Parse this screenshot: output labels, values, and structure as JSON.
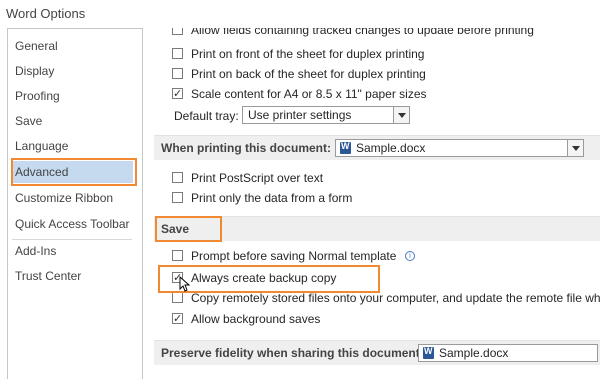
{
  "window": {
    "title": "Word Options"
  },
  "nav": {
    "items": [
      {
        "label": "General"
      },
      {
        "label": "Display"
      },
      {
        "label": "Proofing"
      },
      {
        "label": "Save"
      },
      {
        "label": "Language"
      },
      {
        "label": "Advanced"
      },
      {
        "label": "Customize Ribbon"
      },
      {
        "label": "Quick Access Toolbar"
      },
      {
        "label": "Add-Ins"
      },
      {
        "label": "Trust Center"
      }
    ],
    "selected": "Advanced"
  },
  "print": {
    "partial_top_label": "Allow fields containing tracked changes to update before printing",
    "front_label": "Print on front of the sheet for duplex printing",
    "back_label": "Print on back of the sheet for duplex printing",
    "scale_label": "Scale content for A4 or 8.5 x 11\" paper sizes",
    "scale_checked": true,
    "default_tray_label": "Default tray:",
    "default_tray_value": "Use printer settings"
  },
  "when_printing": {
    "title": "When printing this document:",
    "document": "Sample.docx",
    "postscript_label": "Print PostScript over text",
    "form_data_label": "Print only the data from a form"
  },
  "save": {
    "title": "Save",
    "prompt_label": "Prompt before saving Normal template",
    "backup_label": "Always create backup copy",
    "backup_checked": true,
    "remote_label": "Copy remotely stored files onto your computer, and update the remote file when sa",
    "background_label": "Allow background saves",
    "background_checked": true
  },
  "fidelity": {
    "title": "Preserve fidelity when sharing this document:",
    "document": "Sample.docx"
  }
}
